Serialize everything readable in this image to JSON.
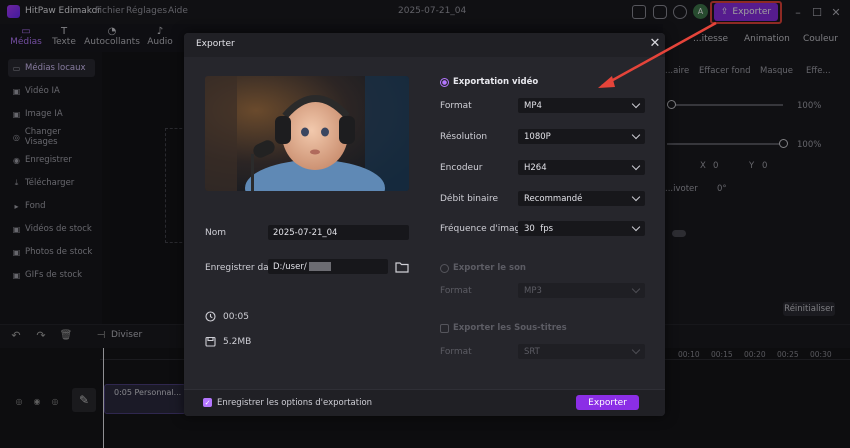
{
  "app": {
    "name": "HitPaw Edimakor",
    "menus": [
      "Fichier",
      "Réglages",
      "Aide"
    ],
    "doc_title": "2025-07-21_04",
    "avatar_letter": "A",
    "export_label": "Exporter"
  },
  "tabs": [
    {
      "label": "Médias",
      "icon": "folder-icon"
    },
    {
      "label": "Texte",
      "icon": "text-icon"
    },
    {
      "label": "Autocollants",
      "icon": "sticker-icon"
    },
    {
      "label": "Audio",
      "icon": "music-icon"
    }
  ],
  "sidebar": {
    "items": [
      {
        "label": "Médias locaux",
        "icon": "folder-icon",
        "active": true
      },
      {
        "label": "Vidéo IA",
        "icon": "video-ai-icon"
      },
      {
        "label": "Image IA",
        "icon": "image-ai-icon"
      },
      {
        "label": "Changer Visages",
        "icon": "face-swap-icon"
      },
      {
        "label": "Enregistrer",
        "icon": "record-icon"
      },
      {
        "label": "Télécharger",
        "icon": "download-icon"
      },
      {
        "label": "Fond",
        "icon": "background-icon"
      },
      {
        "label": "Vidéos de stock",
        "icon": "stock-video-icon"
      },
      {
        "label": "Photos de stock",
        "icon": "stock-photo-icon"
      },
      {
        "label": "GIFs de stock",
        "icon": "gif-icon"
      }
    ]
  },
  "right_panel": {
    "tabs": [
      "...itesse",
      "Animation",
      "Couleur"
    ],
    "subtabs": [
      "...aire",
      "Effacer fond",
      "Masque",
      "Effe..."
    ],
    "percent1": "100%",
    "percent2": "100%",
    "x_label": "X",
    "x_value": "0",
    "y_label": "Y",
    "y_value": "0",
    "rotate_label": "...ivoter",
    "rotate_value": "0°",
    "reset_label": "Réinitialiser"
  },
  "timeline": {
    "split_label": "Diviser",
    "ticks": [
      "00:10",
      "00:15",
      "00:20",
      "00:25",
      "00:30"
    ],
    "clip_label": "0:05 Personnal..."
  },
  "dialog": {
    "title": "Exporter",
    "name_label": "Nom",
    "name_value": "2025-07-21_04",
    "save_in_label": "Enregistrer dans",
    "save_in_value": "D:/user/",
    "duration": "00:05",
    "size": "5.2MB",
    "video_section": "Exportation vidéo",
    "video_fields": [
      {
        "label": "Format",
        "value": "MP4"
      },
      {
        "label": "Résolution",
        "value": "1080P"
      },
      {
        "label": "Encodeur",
        "value": "H264"
      },
      {
        "label": "Débit binaire",
        "value": "Recommandé"
      },
      {
        "label": "Fréquence d'image",
        "value": "30  fps"
      }
    ],
    "audio_section": "Exporter le son",
    "audio_format_label": "Format",
    "audio_format_value": "MP3",
    "subs_section": "Exporter les Sous-titres",
    "subs_format_label": "Format",
    "subs_format_value": "SRT",
    "save_options_label": "Enregistrer les options d'exportation",
    "export_button": "Exporter"
  },
  "colors": {
    "accent": "#8b2ee6",
    "highlight": "#b476ff",
    "annotation": "#e5443a"
  }
}
